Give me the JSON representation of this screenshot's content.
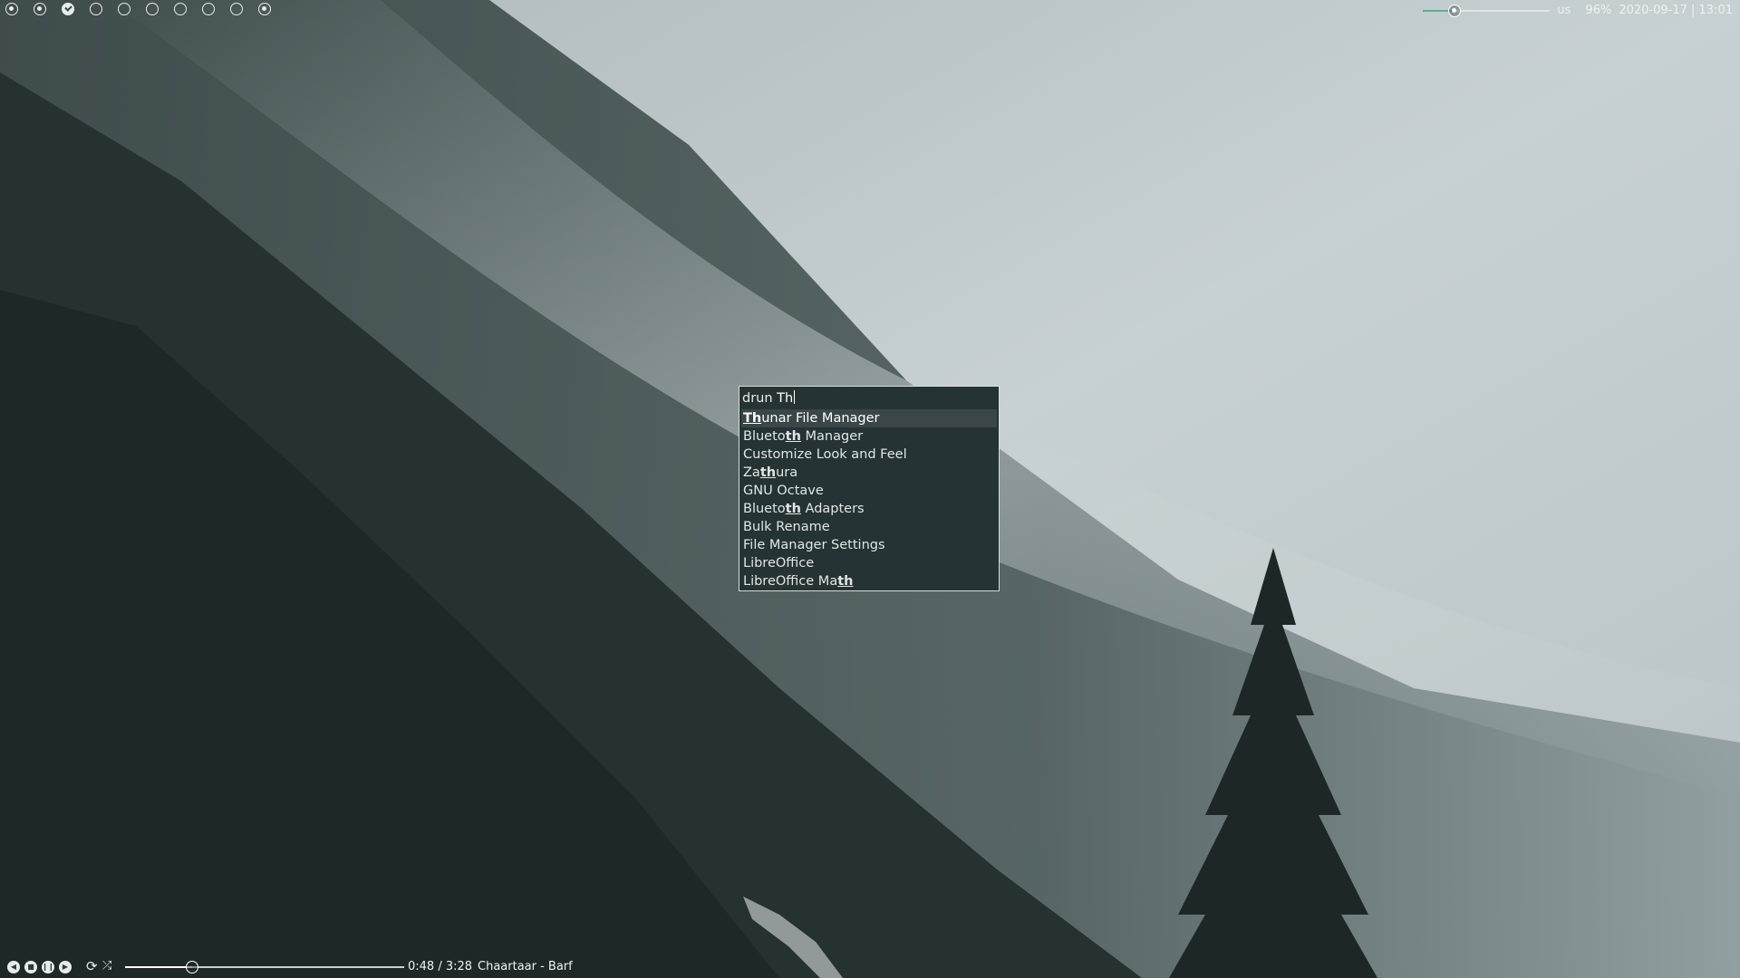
{
  "desktop": {
    "wallpaper": "misty forested mountainside"
  },
  "topbar": {
    "workspaces": [
      {
        "state": "occupied"
      },
      {
        "state": "occupied"
      },
      {
        "state": "focused"
      },
      {
        "state": "empty"
      },
      {
        "state": "empty"
      },
      {
        "state": "empty"
      },
      {
        "state": "empty"
      },
      {
        "state": "empty"
      },
      {
        "state": "empty"
      },
      {
        "state": "occupied"
      }
    ],
    "volume_level": 0.25,
    "keyboard_layout": "us",
    "battery": "96%",
    "datetime": "2020-09-17 | 13:01"
  },
  "launcher": {
    "prompt": "drun",
    "query": "Th",
    "results": [
      {
        "parts": [
          [
            "Th",
            true
          ],
          [
            "unar File Manager",
            false
          ]
        ],
        "selected": true
      },
      {
        "parts": [
          [
            "Blueto",
            false
          ],
          [
            "th",
            true
          ],
          [
            " Manager",
            false
          ]
        ]
      },
      {
        "parts": [
          [
            "Customize Look and Feel",
            false
          ]
        ]
      },
      {
        "parts": [
          [
            "Za",
            false
          ],
          [
            "th",
            true
          ],
          [
            "ura",
            false
          ]
        ]
      },
      {
        "parts": [
          [
            "GNU Octave",
            false
          ]
        ]
      },
      {
        "parts": [
          [
            "Blueto",
            false
          ],
          [
            "th",
            true
          ],
          [
            " Adapters",
            false
          ]
        ]
      },
      {
        "parts": [
          [
            "Bulk Rename",
            false
          ]
        ]
      },
      {
        "parts": [
          [
            "File Manager Settings",
            false
          ]
        ]
      },
      {
        "parts": [
          [
            "LibreOffice",
            false
          ]
        ]
      },
      {
        "parts": [
          [
            "LibreOffice Ma",
            false
          ],
          [
            "th",
            true
          ]
        ]
      }
    ]
  },
  "media": {
    "controls": {
      "prev_icon": "previous-icon",
      "stop_icon": "stop-icon",
      "pause_icon": "pause-icon",
      "next_icon": "next-icon",
      "repeat_icon": "repeat-icon",
      "shuffle_icon": "shuffle-icon"
    },
    "progress": 0.24,
    "time": "0:48 / 3:28",
    "title": "Chaartaar - Barf"
  },
  "colors": {
    "launcher_bg": "#253334",
    "launcher_selected": "#3a4647",
    "volume_accent": "#5fb08a"
  }
}
